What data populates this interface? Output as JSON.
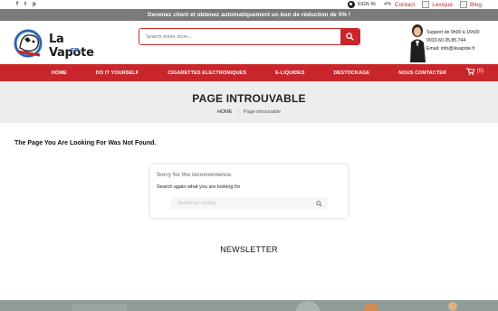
{
  "topbar": {
    "social": [
      "f",
      "t",
      "p"
    ],
    "signin_label": "SIGN IN",
    "contact_label": "Contact",
    "lexique_label": "Lexique",
    "blog_label": "Blog"
  },
  "promo": {
    "text": "Devenez client et obtenez automatiquement un bon de réduction de 5% !"
  },
  "header": {
    "logo_text": "La Vapote",
    "logo_sub": ".FR",
    "search_placeholder": "Search entire store...",
    "support_lines": [
      "Support de 9h00 à 16h00",
      "0033.60.35.85.744",
      "Email: info@lavapote.fr"
    ]
  },
  "nav": {
    "items": [
      "HOME",
      "DO IT YOURSELF",
      "CIGARETTES ELECTRONIQUES",
      "E-LIQUIDES",
      "DESTOCKAGE",
      "NOUS CONTACTER"
    ],
    "cart_count": "(0)"
  },
  "banner": {
    "title": "PAGE INTROUVABLE",
    "breadcrumb_home": "HOME",
    "breadcrumb_separator": "/",
    "breadcrumb_current": "Page introuvable"
  },
  "main": {
    "not_found": "The Page You Are Looking For Was Not Found.",
    "sorry": "Sorry for the inconvenience.",
    "search_again": "Search again what you are looking for",
    "search_placeholder": "Search our catalog"
  },
  "newsletter": {
    "title": "NEWSLETTER"
  },
  "colors": {
    "accent": "#c9262c",
    "promo_bg": "#7a7a7a",
    "banner_bg": "#ededed"
  }
}
